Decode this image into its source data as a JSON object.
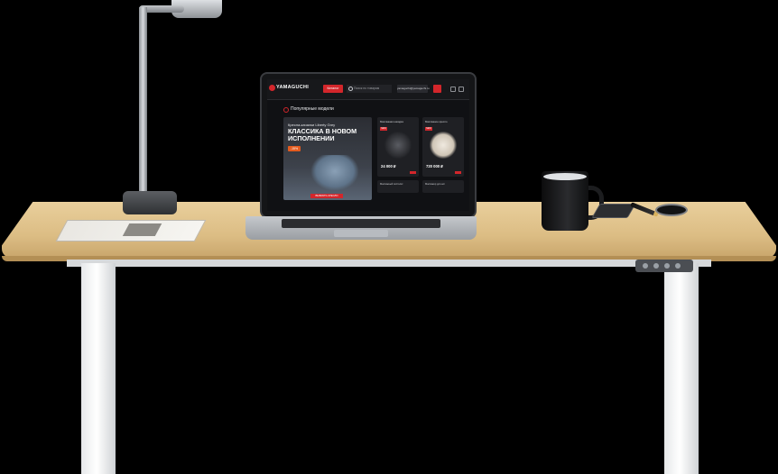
{
  "scene": {
    "description_items": [
      "lamp",
      "magazine",
      "laptop",
      "mug",
      "phone",
      "pen",
      "desk"
    ]
  },
  "laptop_screen": {
    "brand": "YAMAGUCHI",
    "header": {
      "catalog_label": "Каталог",
      "search_placeholder": "Поиск по товарам",
      "email_label": "yamaguchi@yamaguchi.ru"
    },
    "section_title": "Популярные модели",
    "hero": {
      "subtitle": "Кресла-качалки Liberty Grey",
      "title": "КЛАССИКА В НОВОМ ИСПОЛНЕНИИ",
      "badge": "-15%",
      "cta": "ВЫБРАТЬ КРЕСЛО"
    },
    "cards": [
      {
        "name": "Массажная накидка",
        "tag": "NEW",
        "price": "24 000 ₽"
      },
      {
        "name": "Массажное кресло",
        "tag": "NEW",
        "price": "720 000 ₽"
      }
    ],
    "small_cards": [
      {
        "name": "Массажный пистолет"
      },
      {
        "name": "Массажер для ног"
      }
    ]
  },
  "colors": {
    "brand_red": "#d3262b",
    "desk_wood": "#dcbd84",
    "background": "#000000"
  }
}
